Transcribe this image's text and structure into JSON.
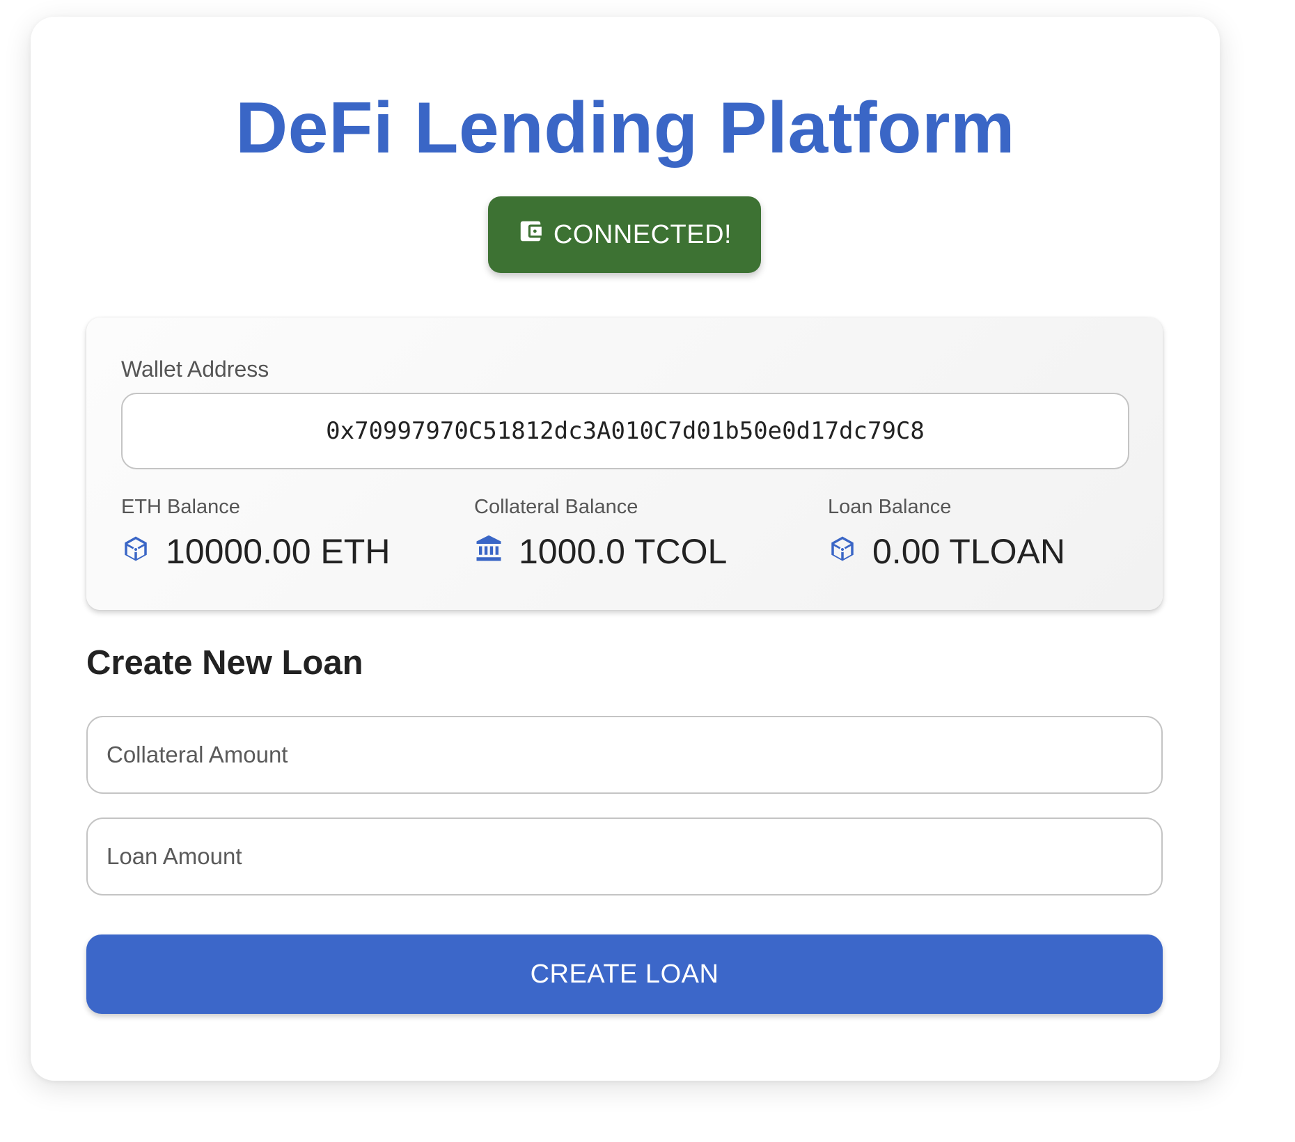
{
  "app": {
    "title": "DeFi Lending Platform"
  },
  "connect_button": {
    "label": "CONNECTED!",
    "icon": "wallet-icon",
    "color": "#3d7233"
  },
  "wallet": {
    "label": "Wallet Address",
    "address": "0x70997970C51812dc3A010C7d01b50e0d17dc79C8"
  },
  "balances": [
    {
      "label": "ETH Balance",
      "value": "10000.00 ETH",
      "icon": "cube-icon"
    },
    {
      "label": "Collateral Balance",
      "value": "1000.0 TCOL",
      "icon": "bank-icon"
    },
    {
      "label": "Loan Balance",
      "value": "0.00 TLOAN",
      "icon": "cube-icon"
    }
  ],
  "loan_form": {
    "title": "Create New Loan",
    "collateral_placeholder": "Collateral Amount",
    "collateral_value": "",
    "loan_placeholder": "Loan Amount",
    "loan_value": "",
    "submit_label": "CREATE LOAN"
  },
  "colors": {
    "accent": "#3a66c6",
    "success": "#3d7233"
  }
}
